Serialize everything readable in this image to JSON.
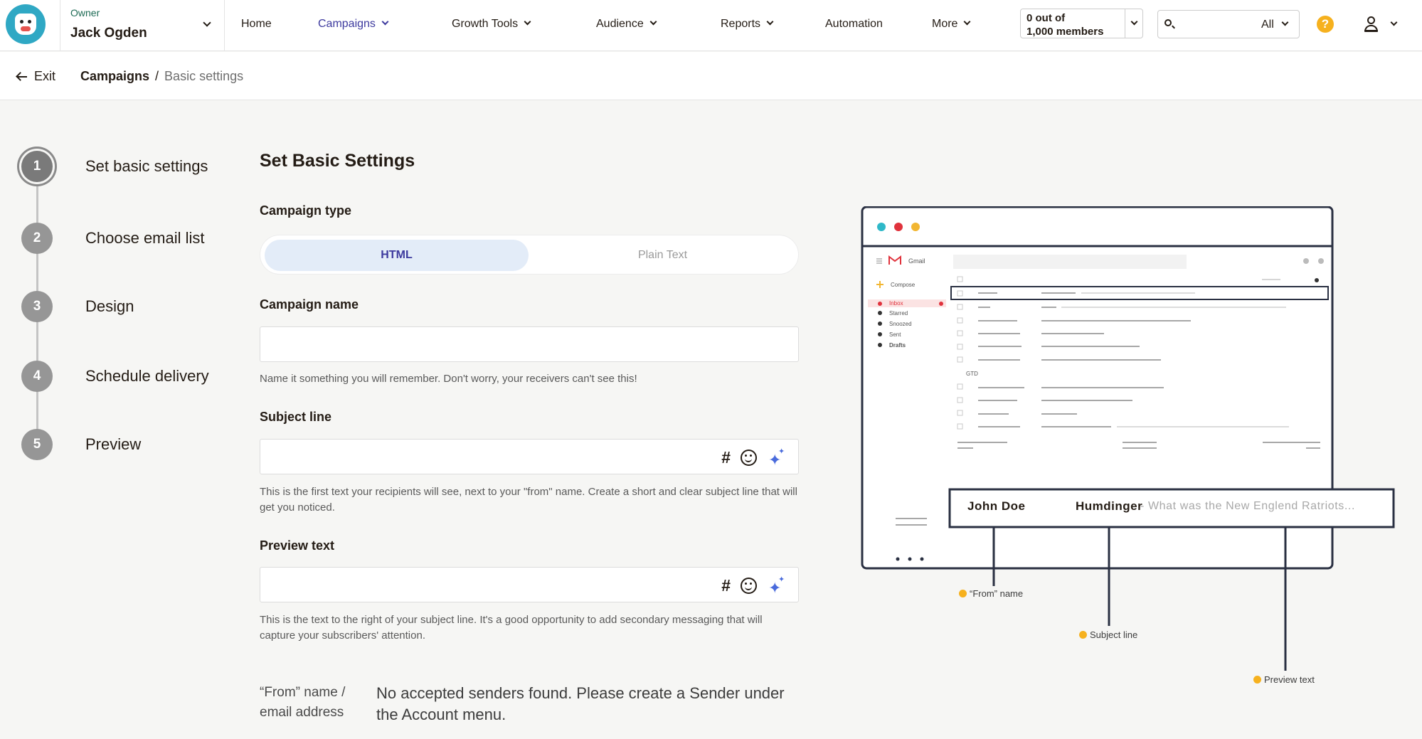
{
  "account": {
    "role": "Owner",
    "name": "Jack Ogden"
  },
  "nav": {
    "home": "Home",
    "campaigns": "Campaigns",
    "growth_tools": "Growth Tools",
    "audience": "Audience",
    "reports": "Reports",
    "automation": "Automation",
    "more": "More"
  },
  "members": {
    "line1": "0 out of",
    "line2": "1,000 members"
  },
  "search": {
    "scope": "All",
    "placeholder": ""
  },
  "help": {
    "glyph": "?"
  },
  "subbar": {
    "exit": "Exit",
    "crumb_parent": "Campaigns",
    "crumb_separator": "/",
    "crumb_current": "Basic settings"
  },
  "steps": [
    {
      "num": "1",
      "label": "Set basic settings"
    },
    {
      "num": "2",
      "label": "Choose email list"
    },
    {
      "num": "3",
      "label": "Design"
    },
    {
      "num": "4",
      "label": "Schedule delivery"
    },
    {
      "num": "5",
      "label": "Preview"
    }
  ],
  "form": {
    "title": "Set Basic Settings",
    "campaign_type_label": "Campaign type",
    "type_html": "HTML",
    "type_plain": "Plain Text",
    "campaign_name_label": "Campaign name",
    "campaign_name_value": "",
    "campaign_name_hint": "Name it something you will remember. Don't worry, your receivers can't see this!",
    "subject_label": "Subject line",
    "subject_value": "",
    "subject_hint": "This is the first text your recipients will see, next to your \"from\" name. Create a short and clear subject line that will get you noticed.",
    "preview_label": "Preview text",
    "preview_value": "",
    "preview_hint": "This is the text to the right of your subject line. It's a good opportunity to add secondary messaging that will capture your subscribers' attention.",
    "hash_glyph": "#",
    "from_label": "“From” name / email address",
    "from_message": "No accepted senders found. Please create a Sender under the Account menu."
  },
  "illustration": {
    "window_dots": [
      "#2fb8c8",
      "#e0323c",
      "#f2b632"
    ],
    "gmail_label": "Gmail",
    "compose": "Compose",
    "folders": [
      "Inbox",
      "Starred",
      "Snoozed",
      "Sent",
      "Drafts"
    ],
    "group_label": "GTD",
    "preview_name": "John Doe",
    "preview_subject": "Humdinger",
    "preview_rest": "- What was the New Englend Ratriots...",
    "callouts": {
      "from": "“From” name",
      "subject": "Subject line",
      "preview": "Preview text"
    }
  },
  "colors": {
    "accent": "#3d3a9e",
    "selected_bg": "#e3ecf8",
    "logo": "#2fa8c4",
    "help": "#f6b11e",
    "callout_dot": "#f6b11e"
  }
}
